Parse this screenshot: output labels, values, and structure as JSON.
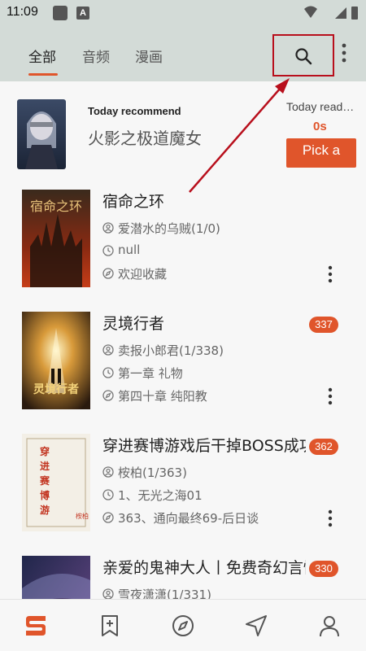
{
  "status_bar": {
    "time": "11:09",
    "notif_letter": "A"
  },
  "tabs": [
    {
      "label": "全部",
      "active": true
    },
    {
      "label": "音频",
      "active": false
    },
    {
      "label": "漫画",
      "active": false
    }
  ],
  "toolbar": {
    "search_icon": "search-icon",
    "more_icon": "more-vert-icon"
  },
  "recommend": {
    "label": "Today recommend",
    "title": "火影之极道魔女",
    "read_label": "Today read…",
    "read_time": "0s",
    "pick_button": "Pick a book"
  },
  "books": [
    {
      "title": "宿命之环",
      "author": "爱潜水的乌贼(1/0)",
      "latest": "null",
      "read": "欢迎收藏",
      "badge": ""
    },
    {
      "title": "灵境行者",
      "author": "卖报小郎君(1/338)",
      "latest": "第一章 礼物",
      "read": "第四十章 纯阳教",
      "badge": "337"
    },
    {
      "title": "穿进赛博游戏后干掉BOSS成功上位",
      "author": "桉柏(1/363)",
      "latest": "1、无光之海01",
      "read": "363、通向最终69-后日谈",
      "badge": "362"
    },
    {
      "title": "亲爱的鬼神大人丨免费奇幻言情",
      "author": "雪夜潇潇(1/331)",
      "latest": "",
      "read": "",
      "badge": "330"
    }
  ],
  "bottom_nav": [
    {
      "icon": "bookshelf-logo-icon",
      "active": true
    },
    {
      "icon": "bookmark-add-icon",
      "active": false
    },
    {
      "icon": "compass-icon",
      "active": false
    },
    {
      "icon": "navigation-arrow-icon",
      "active": false
    },
    {
      "icon": "person-icon",
      "active": false
    }
  ],
  "colors": {
    "accent": "#e0552b",
    "header_bg": "#d3dbd7",
    "highlight_red": "#b80f1c"
  }
}
